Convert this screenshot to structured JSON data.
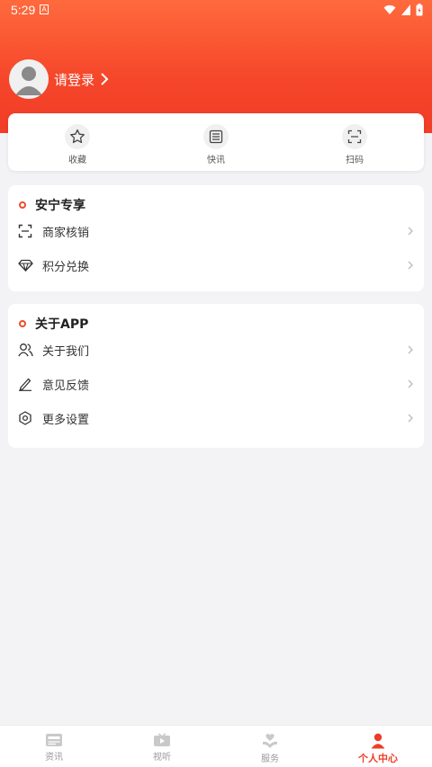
{
  "status": {
    "time": "5:29",
    "indicator": "A"
  },
  "profile": {
    "login_label": "请登录"
  },
  "quick_actions": [
    {
      "label": "收藏",
      "icon": "star-icon"
    },
    {
      "label": "快讯",
      "icon": "list-icon"
    },
    {
      "label": "扫码",
      "icon": "scan-icon"
    }
  ],
  "section_anning": {
    "title": "安宁专享",
    "items": [
      {
        "label": "商家核销",
        "icon": "scan-frame-icon"
      },
      {
        "label": "积分兑换",
        "icon": "diamond-icon"
      }
    ]
  },
  "section_about": {
    "title": "关于APP",
    "items": [
      {
        "label": "关于我们",
        "icon": "users-icon"
      },
      {
        "label": "意见反馈",
        "icon": "pencil-icon"
      },
      {
        "label": "更多设置",
        "icon": "settings-icon"
      }
    ]
  },
  "tabs": [
    {
      "label": "资讯",
      "icon": "news-icon",
      "active": false
    },
    {
      "label": "视听",
      "icon": "video-icon",
      "active": false
    },
    {
      "label": "服务",
      "icon": "service-heart-icon",
      "active": false
    },
    {
      "label": "个人中心",
      "icon": "person-icon",
      "active": true
    }
  ],
  "colors": {
    "accent": "#f03b27",
    "header_top": "#ff6a3d",
    "background": "#f3f3f5"
  }
}
